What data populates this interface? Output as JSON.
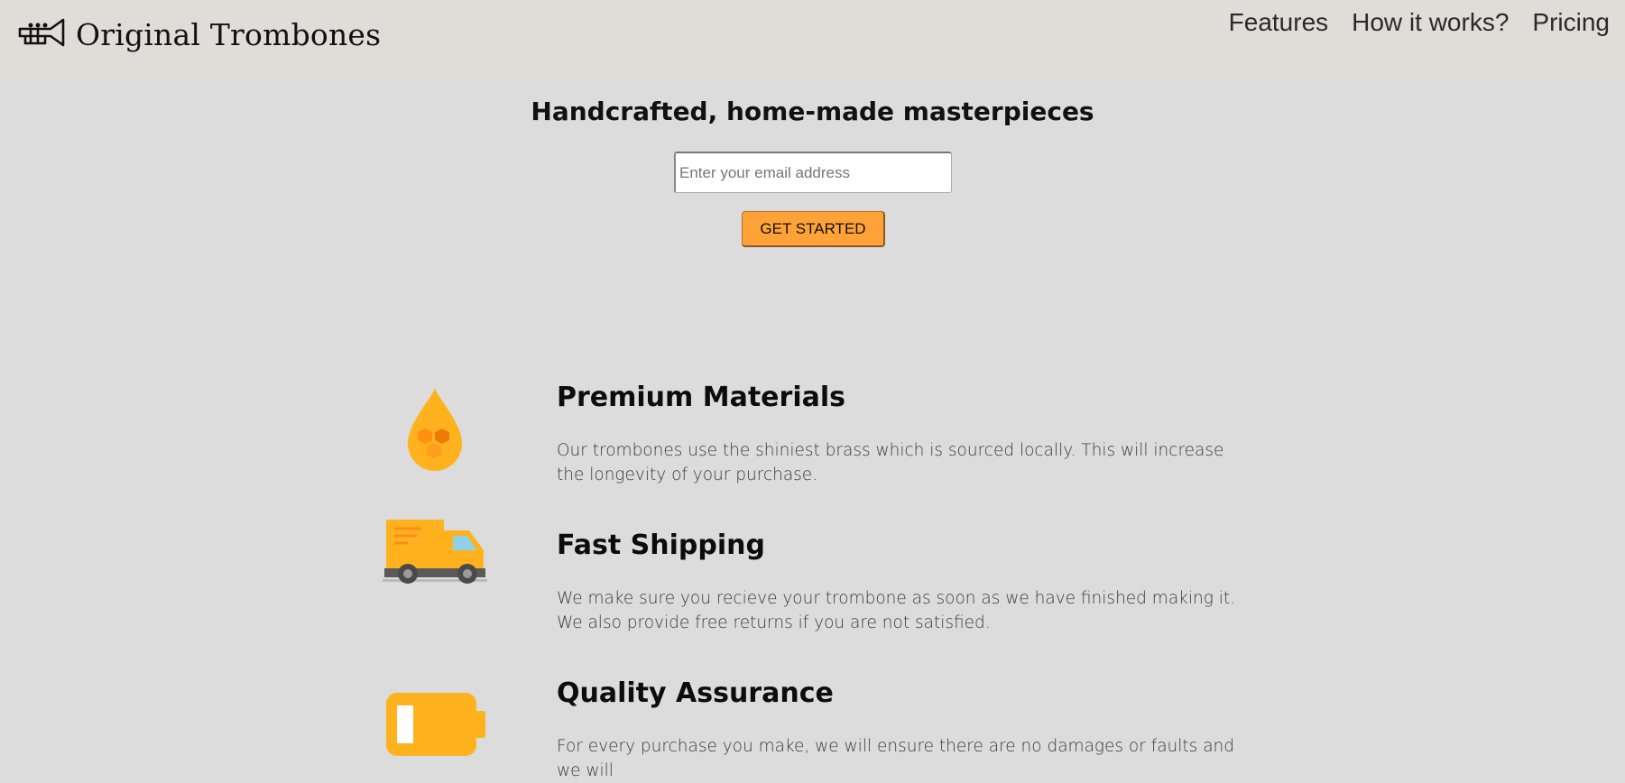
{
  "header": {
    "logo_text": "Original Trombones",
    "logo_icon": "trombone-icon",
    "nav": [
      {
        "label": "Features"
      },
      {
        "label": "How it works?"
      },
      {
        "label": "Pricing"
      }
    ]
  },
  "hero": {
    "title": "Handcrafted, home-made masterpieces",
    "email_placeholder": "Enter your email address",
    "email_value": "",
    "cta_label": "GET STARTED"
  },
  "features": [
    {
      "icon": "brass-drop-icon",
      "title": "Premium Materials",
      "description": "Our trombones use the shiniest brass which is sourced locally. This will increase the longevity of your purchase."
    },
    {
      "icon": "delivery-truck-icon",
      "title": "Fast Shipping",
      "description": "We make sure you recieve your trombone as soon as we have finished making it. We also provide free returns if you are not satisfied."
    },
    {
      "icon": "battery-icon",
      "title": "Quality Assurance",
      "description": "For every purchase you make, we will ensure there are no damages or faults and we will"
    }
  ],
  "colors": {
    "page_background": "#dcdcdc",
    "header_background": "#dfddd8",
    "accent": "#ffa238",
    "icon_orange": "#ffb21e"
  }
}
